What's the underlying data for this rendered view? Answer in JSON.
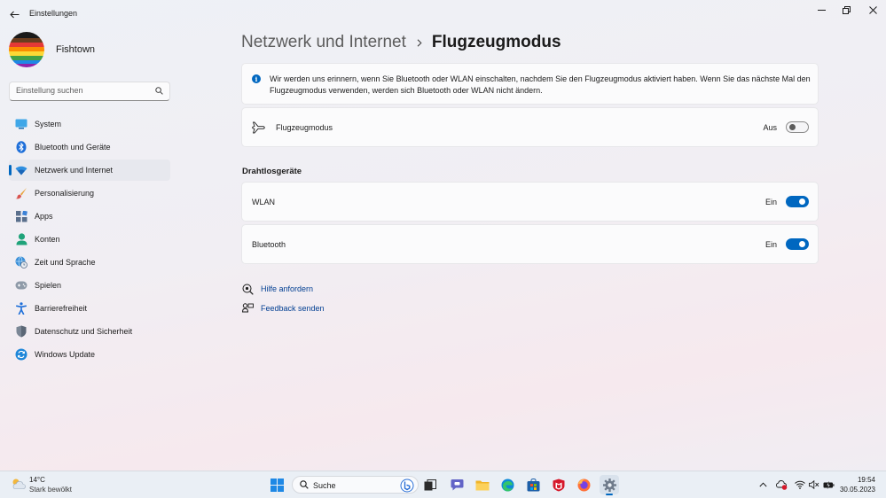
{
  "app": {
    "title": "Einstellungen"
  },
  "profile": {
    "name": "Fishtown"
  },
  "search": {
    "placeholder": "Einstellung suchen"
  },
  "sidebar": {
    "items": [
      {
        "label": "System",
        "icon": "monitor-icon",
        "active": false
      },
      {
        "label": "Bluetooth und Geräte",
        "icon": "bluetooth-icon",
        "active": false
      },
      {
        "label": "Netzwerk und Internet",
        "icon": "wifi-icon",
        "active": true
      },
      {
        "label": "Personalisierung",
        "icon": "brush-icon",
        "active": false
      },
      {
        "label": "Apps",
        "icon": "apps-icon",
        "active": false
      },
      {
        "label": "Konten",
        "icon": "account-icon",
        "active": false
      },
      {
        "label": "Zeit und Sprache",
        "icon": "globe-clock-icon",
        "active": false
      },
      {
        "label": "Spielen",
        "icon": "gamepad-icon",
        "active": false
      },
      {
        "label": "Barrierefreiheit",
        "icon": "accessibility-icon",
        "active": false
      },
      {
        "label": "Datenschutz und Sicherheit",
        "icon": "shield-icon",
        "active": false
      },
      {
        "label": "Windows Update",
        "icon": "update-icon",
        "active": false
      }
    ]
  },
  "breadcrumb": {
    "parent": "Netzwerk und Internet",
    "current": "Flugzeugmodus"
  },
  "info": {
    "text": "Wir werden uns erinnern, wenn Sie Bluetooth oder WLAN einschalten, nachdem Sie den Flugzeugmodus aktiviert haben. Wenn Sie das nächste Mal den Flugzeugmodus verwenden, werden sich Bluetooth oder WLAN nicht ändern."
  },
  "airplane": {
    "label": "Flugzeugmodus",
    "state": "Aus",
    "on": false
  },
  "wireless": {
    "title": "Drahtlosgeräte",
    "wlan": {
      "label": "WLAN",
      "state": "Ein",
      "on": true
    },
    "bluetooth": {
      "label": "Bluetooth",
      "state": "Ein",
      "on": true
    }
  },
  "links": {
    "help": "Hilfe anfordern",
    "feedback": "Feedback senden"
  },
  "taskbar": {
    "weather_temp": "14°C",
    "weather_desc": "Stark bewölkt",
    "search_label": "Suche",
    "time": "19:54",
    "date": "30.05.2023"
  },
  "colors": {
    "accent": "#0067c0",
    "link": "#003e92"
  }
}
